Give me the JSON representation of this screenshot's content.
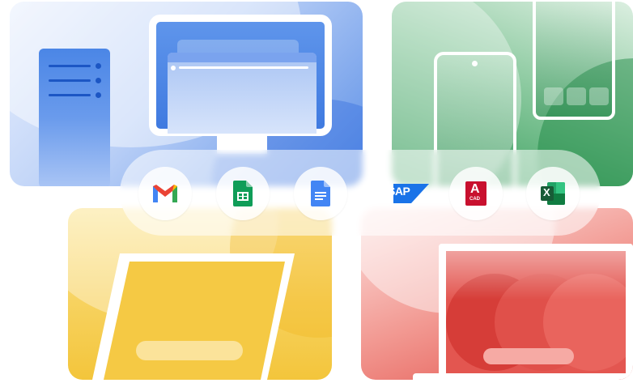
{
  "icons": [
    {
      "name": "gmail",
      "label": ""
    },
    {
      "name": "sheets",
      "label": ""
    },
    {
      "name": "docs",
      "label": ""
    },
    {
      "name": "sap",
      "label": "SAP"
    },
    {
      "name": "autocad",
      "label": "A",
      "sublabel": "CAD"
    },
    {
      "name": "excel",
      "label": "X"
    }
  ],
  "colors": {
    "blue": "#4a86e8",
    "green": "#34a853",
    "yellow": "#f6c93a",
    "red": "#e8524a",
    "gmail_red": "#ea4335",
    "sheets_green": "#0f9d58",
    "docs_blue": "#4285f4",
    "sap_blue": "#1a73e8",
    "autocad_red": "#c8102e",
    "excel_green": "#107c41"
  }
}
